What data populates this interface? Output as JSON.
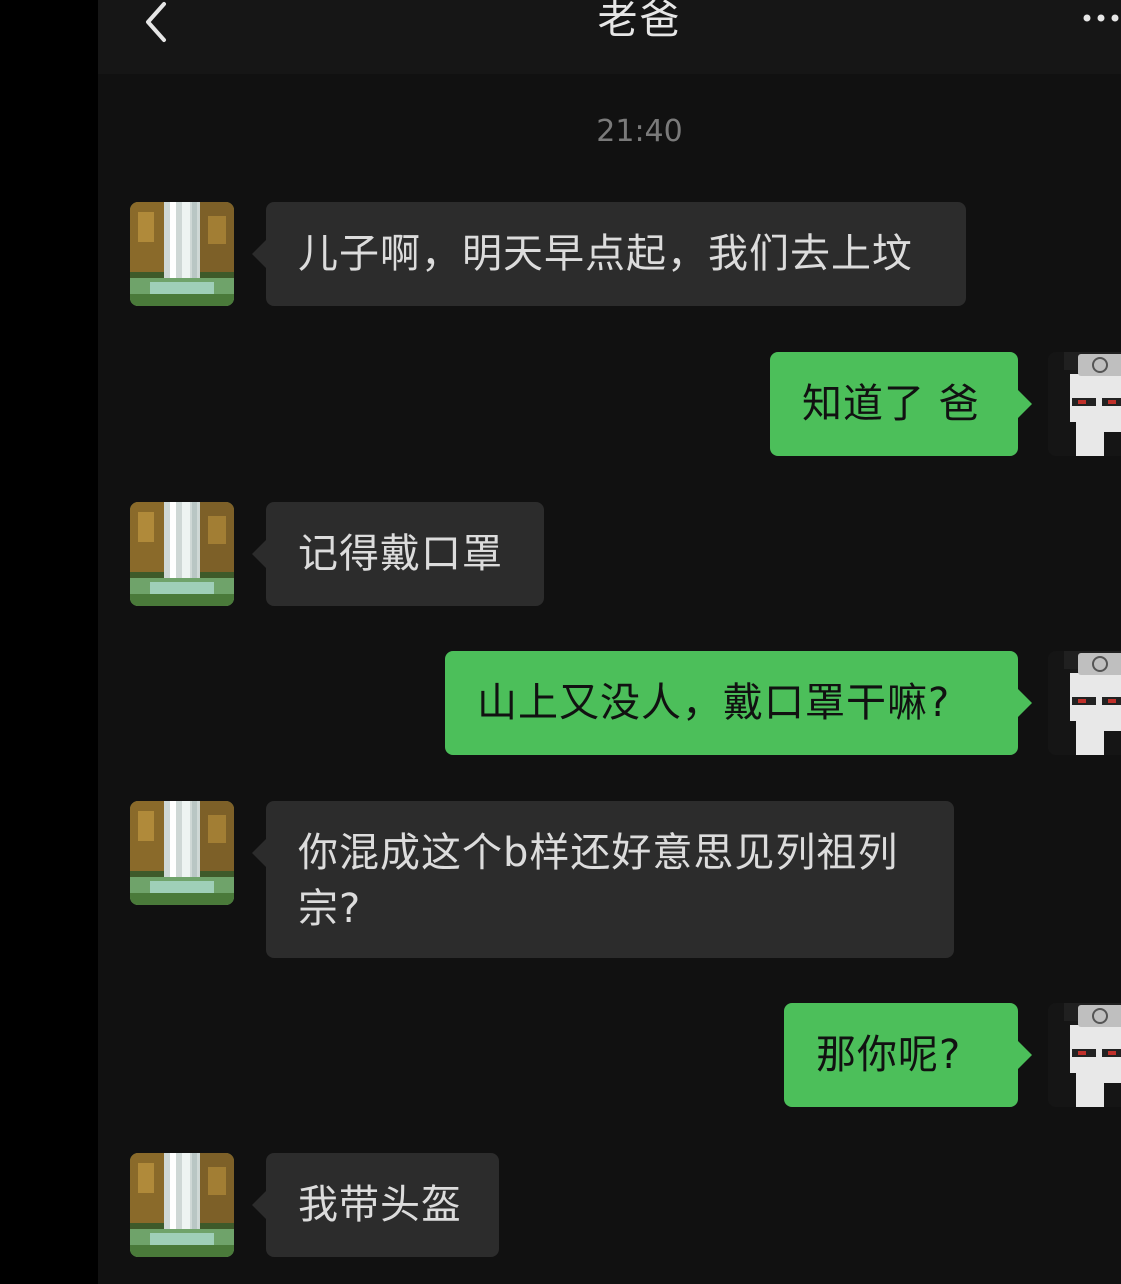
{
  "header": {
    "contact_name": "老爸"
  },
  "timestamp": "21:40",
  "colors": {
    "incoming_bubble": "#2c2c2c",
    "outgoing_bubble": "#4cbf5a",
    "background": "#111111"
  },
  "icons": {
    "back": "chevron-left-icon",
    "more": "more-dots-icon",
    "contact_avatar": "waterfall-avatar",
    "my_avatar": "anime-ninja-avatar"
  },
  "messages": [
    {
      "sender": "contact",
      "text": "儿子啊，明天早点起，我们去上坟"
    },
    {
      "sender": "me",
      "text": "知道了 爸"
    },
    {
      "sender": "contact",
      "text": "记得戴口罩"
    },
    {
      "sender": "me",
      "text": "山上又没人，戴口罩干嘛?"
    },
    {
      "sender": "contact",
      "text": "你混成这个b样还好意思见列祖列宗?"
    },
    {
      "sender": "me",
      "text": "那你呢?"
    },
    {
      "sender": "contact",
      "text": "我带头盔"
    }
  ]
}
